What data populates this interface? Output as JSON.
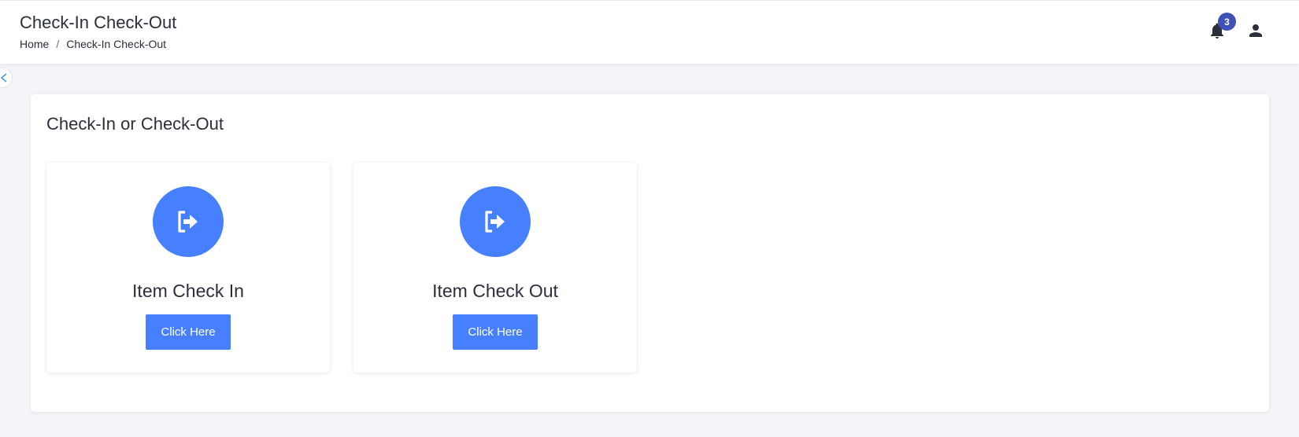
{
  "header": {
    "title": "Check-In Check-Out",
    "breadcrumb": [
      {
        "label": "Home"
      },
      {
        "label": "Check-In Check-Out"
      }
    ],
    "breadcrumb_separator": "/",
    "notifications_count": "3",
    "icons": {
      "notifications": "bell-icon",
      "user": "user-icon",
      "collapse": "chevron-left-icon"
    }
  },
  "main": {
    "section_title": "Check-In or Check-Out",
    "options": [
      {
        "label": "Item Check In",
        "button_label": "Click Here",
        "icon": "sign-out-icon"
      },
      {
        "label": "Item Check Out",
        "button_label": "Click Here",
        "icon": "sign-out-icon"
      }
    ]
  },
  "colors": {
    "accent": "#4680fe",
    "badge": "#3f51b5",
    "background": "#f4f5f8",
    "text": "#2b2f3a"
  }
}
